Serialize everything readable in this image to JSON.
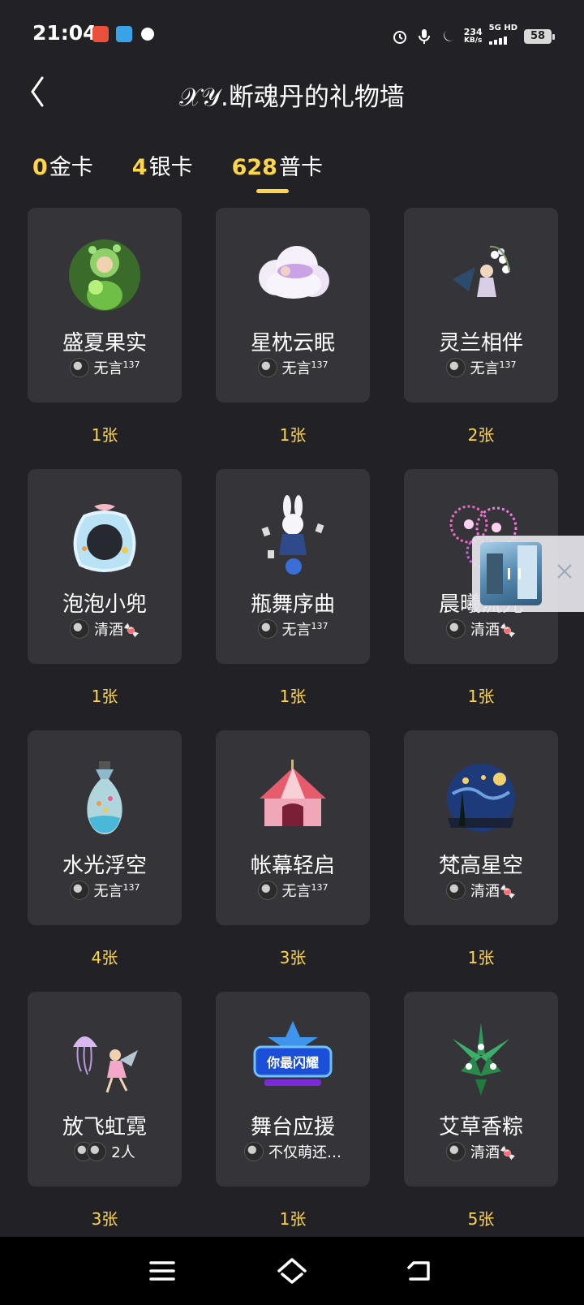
{
  "status_bar": {
    "time": "21:04",
    "net_speed_value": "234",
    "net_speed_unit": "KB/s",
    "network_type": "5G HD",
    "battery": "58"
  },
  "header": {
    "title": "𝒳𝒴.断魂丹的礼物墙"
  },
  "tabs": [
    {
      "count": "0",
      "label": "金卡",
      "active": false
    },
    {
      "count": "4",
      "label": "银卡",
      "active": false
    },
    {
      "count": "628",
      "label": "普卡",
      "active": true
    }
  ],
  "gifts": [
    {
      "name": "盛夏果实",
      "giver": "无言",
      "giver_sup": "137",
      "count": "1张",
      "icon": "forest-fairy-icon"
    },
    {
      "name": "星枕云眠",
      "giver": "无言",
      "giver_sup": "137",
      "count": "1张",
      "icon": "cloud-pillow-icon"
    },
    {
      "name": "灵兰相伴",
      "giver": "无言",
      "giver_sup": "137",
      "count": "2张",
      "icon": "orchid-fairy-icon"
    },
    {
      "name": "泡泡小兜",
      "giver": "清酒",
      "giver_emoji": "🍬",
      "count": "1张",
      "icon": "bubble-pouch-icon"
    },
    {
      "name": "瓶舞序曲",
      "giver": "无言",
      "giver_sup": "137",
      "count": "1张",
      "icon": "rabbit-magician-icon"
    },
    {
      "name": "晨曦流光",
      "giver": "清酒",
      "giver_emoji": "🍬",
      "count": "1张",
      "icon": "fireworks-icon"
    },
    {
      "name": "水光浮空",
      "giver": "无言",
      "giver_sup": "137",
      "count": "4张",
      "icon": "lightbulb-aquarium-icon"
    },
    {
      "name": "帐幕轻启",
      "giver": "无言",
      "giver_sup": "137",
      "count": "3张",
      "icon": "circus-tent-icon"
    },
    {
      "name": "梵高星空",
      "giver": "清酒",
      "giver_emoji": "🍬",
      "count": "1张",
      "icon": "starry-night-icon"
    },
    {
      "name": "放飞虹霓",
      "giver": "2人",
      "count": "3张",
      "icon": "jellyfish-fairy-icon"
    },
    {
      "name": "舞台应援",
      "giver": "不仅萌还…",
      "count": "1张",
      "icon": "stage-sign-icon",
      "sign_text": "你最闪耀"
    },
    {
      "name": "艾草香粽",
      "giver": "清酒",
      "giver_emoji": "🍬",
      "count": "5张",
      "icon": "mugwort-zongzi-icon"
    }
  ],
  "colors": {
    "background": "#222226",
    "card": "#353539",
    "accent": "#ffd54a"
  }
}
